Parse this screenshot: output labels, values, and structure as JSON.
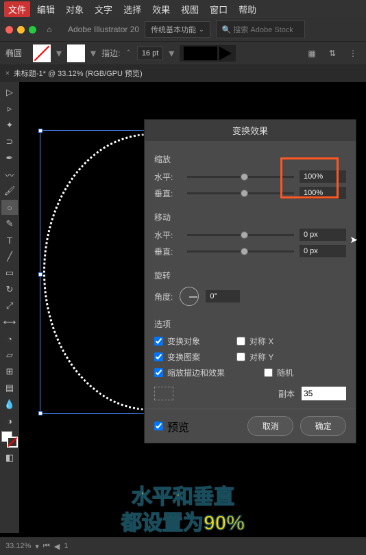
{
  "menubar": {
    "items": [
      "文件",
      "编辑",
      "对象",
      "文字",
      "选择",
      "效果",
      "视图",
      "窗口",
      "帮助"
    ]
  },
  "topbar": {
    "app": "Adobe Illustrator 20",
    "workspace": "传统基本功能",
    "search_ph": "搜索 Adobe Stock"
  },
  "options": {
    "shape": "椭圆",
    "stroke_label": "描边:",
    "stroke_pt": "16 pt"
  },
  "tab": {
    "title": "未标题-1* @ 33.12% (RGB/GPU 预览)"
  },
  "dialog": {
    "title": "变换效果",
    "scale": {
      "title": "缩放",
      "h_label": "水平:",
      "v_label": "垂直:",
      "h_val": "100%",
      "v_val": "100%"
    },
    "move": {
      "title": "移动",
      "h_label": "水平:",
      "v_label": "垂直:",
      "h_val": "0 px",
      "v_val": "0 px"
    },
    "rotate": {
      "title": "旋转",
      "angle_label": "角度:",
      "angle_val": "0°"
    },
    "opts": {
      "title": "选项",
      "transform_obj": "变换对象",
      "reflect_x": "对称 X",
      "transform_pat": "变换图案",
      "reflect_y": "对称 Y",
      "scale_stroke": "缩放描边和效果",
      "random": "随机"
    },
    "copies": {
      "label": "副本",
      "val": "35"
    },
    "preview": "预览",
    "cancel": "取消",
    "ok": "确定"
  },
  "status": {
    "zoom": "33.12%",
    "page": "1"
  },
  "subtitle": {
    "line1": "水平和垂直",
    "line2": "都设置为90%"
  }
}
